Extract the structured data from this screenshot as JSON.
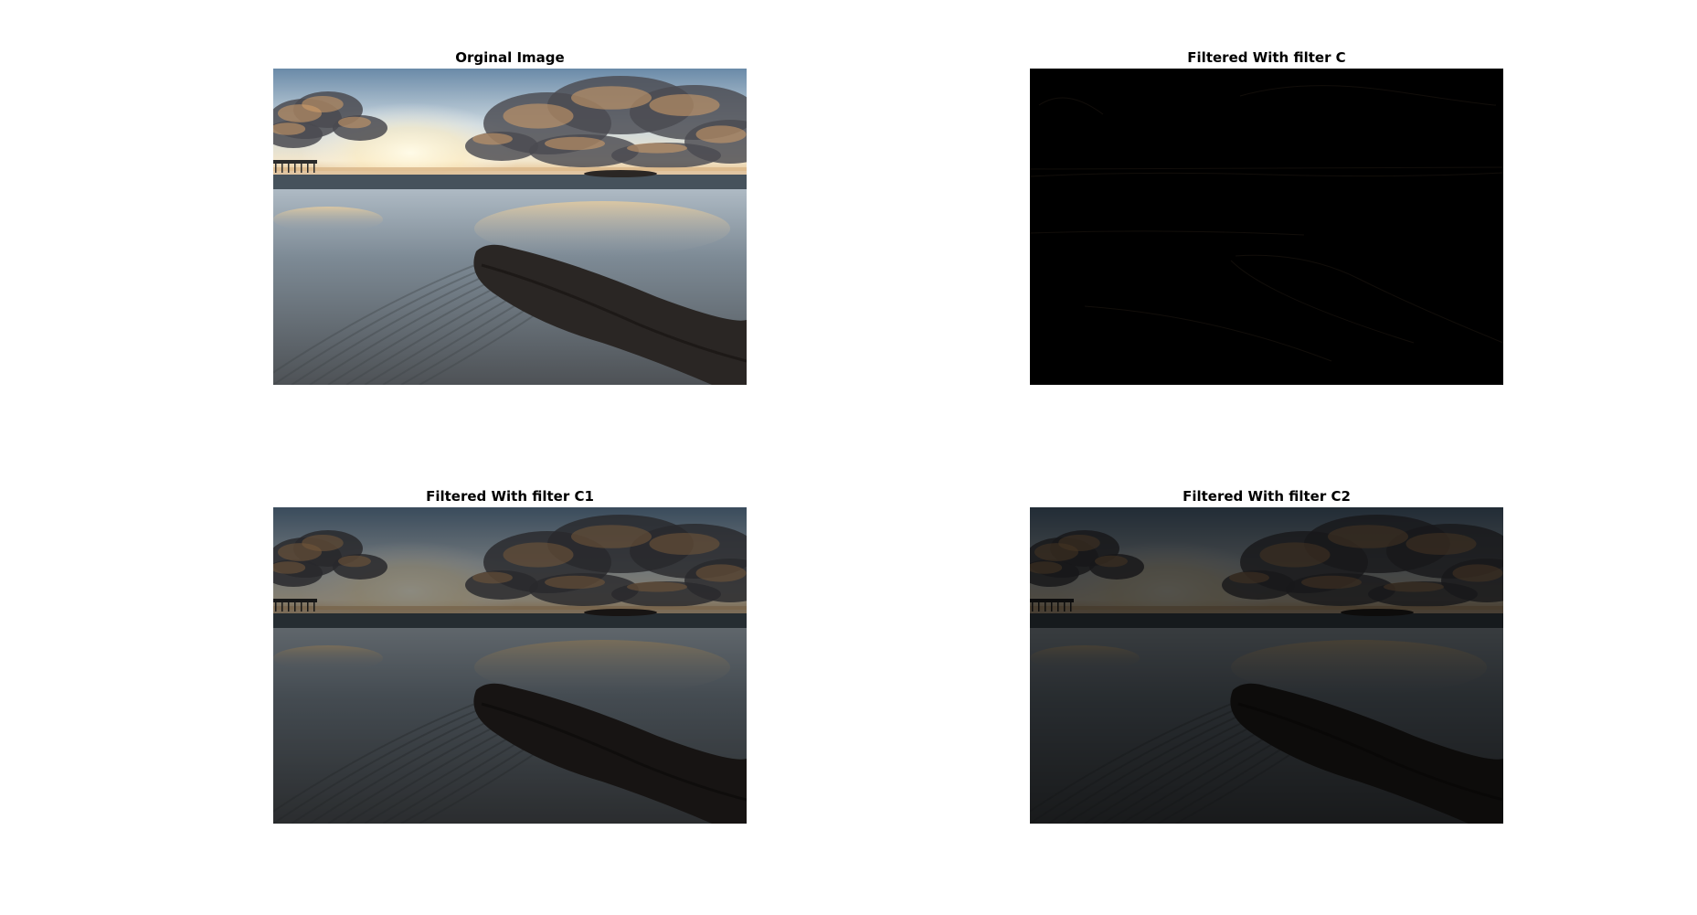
{
  "figure": {
    "panels": [
      {
        "title": "Orginal Image",
        "filter": "none",
        "brightness": 1.0
      },
      {
        "title": "Filtered With filter C",
        "filter": "edge",
        "brightness": 0.03
      },
      {
        "title": "Filtered With filter C1",
        "filter": "darken",
        "brightness": 0.55
      },
      {
        "title": "Filtered With filter C2",
        "filter": "darken",
        "brightness": 0.32
      }
    ]
  },
  "colors": {
    "sky_top": "#5f7f9f",
    "sky_horizon": "#f2e6cc",
    "sun_glow": "#fff4d2",
    "cloud_dark": "#4a4a50",
    "cloud_warm": "#d6a16a",
    "sea": "#6e7f8c",
    "sand": "#8c8f92",
    "rock": "#2a2624",
    "figure_bg": "#ffffff",
    "text": "#000000"
  }
}
